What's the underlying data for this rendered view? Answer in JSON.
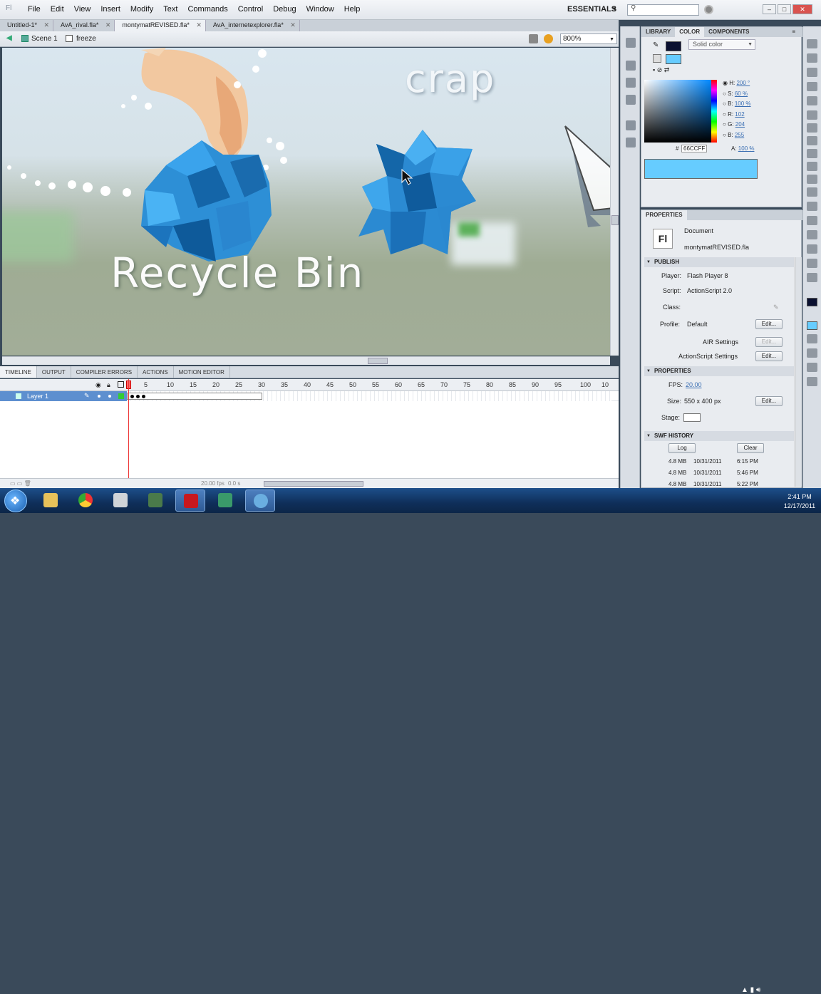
{
  "menubar": {
    "menus": [
      "File",
      "Edit",
      "View",
      "Insert",
      "Modify",
      "Text",
      "Commands",
      "Control",
      "Debug",
      "Window",
      "Help"
    ],
    "workspace": "ESSENTIALS",
    "search_placeholder": ""
  },
  "doc_tabs": [
    {
      "label": "Untitled-1*",
      "active": false
    },
    {
      "label": "AvA_rival.fla*",
      "active": false
    },
    {
      "label": "montymatREVISED.fla*",
      "active": true
    },
    {
      "label": "AvA_internetexplorer.fla*",
      "active": false
    }
  ],
  "editbar": {
    "scene": "Scene 1",
    "symbol": "freeze",
    "zoom": "800%"
  },
  "stage": {
    "text_top": "crap",
    "text_bottom": "Recycle Bin"
  },
  "timeline": {
    "tabs": [
      "TIMELINE",
      "OUTPUT",
      "COMPILER ERRORS",
      "ACTIONS",
      "MOTION EDITOR"
    ],
    "ruler": [
      "1",
      "5",
      "10",
      "15",
      "20",
      "25",
      "30",
      "35",
      "40",
      "45",
      "50",
      "55",
      "60",
      "65",
      "70",
      "75",
      "80",
      "85",
      "90",
      "95",
      "100",
      "10"
    ],
    "layer": "Layer 1",
    "footer_fps": "20.00 fps",
    "footer_time": "0.0 s"
  },
  "color_panel": {
    "tabs": [
      "LIBRARY",
      "COLOR",
      "COMPONENTS"
    ],
    "type": "Solid color",
    "h_label": "H:",
    "h": "200 °",
    "s_label": "S:",
    "s": "60 %",
    "b_label": "B:",
    "b": "100 %",
    "r_label": "R:",
    "r": "102",
    "g_label": "G:",
    "g": "204",
    "bl_label": "B:",
    "bl": "255",
    "hex_label": "#",
    "hex": "66CCFF",
    "a_label": "A:",
    "a": "100 %",
    "fill_color": "#66CCFF"
  },
  "properties": {
    "tab": "PROPERTIES",
    "doc_icon": "Fl",
    "doc_type": "Document",
    "doc_name": "montymatREVISED.fla",
    "publish_title": "PUBLISH",
    "player_label": "Player:",
    "player": "Flash Player 8",
    "script_label": "Script:",
    "script": "ActionScript 2.0",
    "class_label": "Class:",
    "profile_label": "Profile:",
    "profile": "Default",
    "air_label": "AIR Settings",
    "as_label": "ActionScript Settings",
    "edit": "Edit...",
    "properties_title": "PROPERTIES",
    "fps_label": "FPS:",
    "fps": "20.00",
    "size_label": "Size:",
    "size": "550 x 400 px",
    "stage_label": "Stage:",
    "swf_title": "SWF HISTORY",
    "log": "Log",
    "clear": "Clear",
    "history": [
      {
        "size": "4.8 MB",
        "date": "10/31/2011",
        "time": "6:15 PM"
      },
      {
        "size": "4.8 MB",
        "date": "10/31/2011",
        "time": "5:46 PM"
      },
      {
        "size": "4.8 MB",
        "date": "10/31/2011",
        "time": "5:22 PM"
      }
    ]
  },
  "taskbar": {
    "time": "2:41 PM",
    "date": "12/17/2011"
  }
}
